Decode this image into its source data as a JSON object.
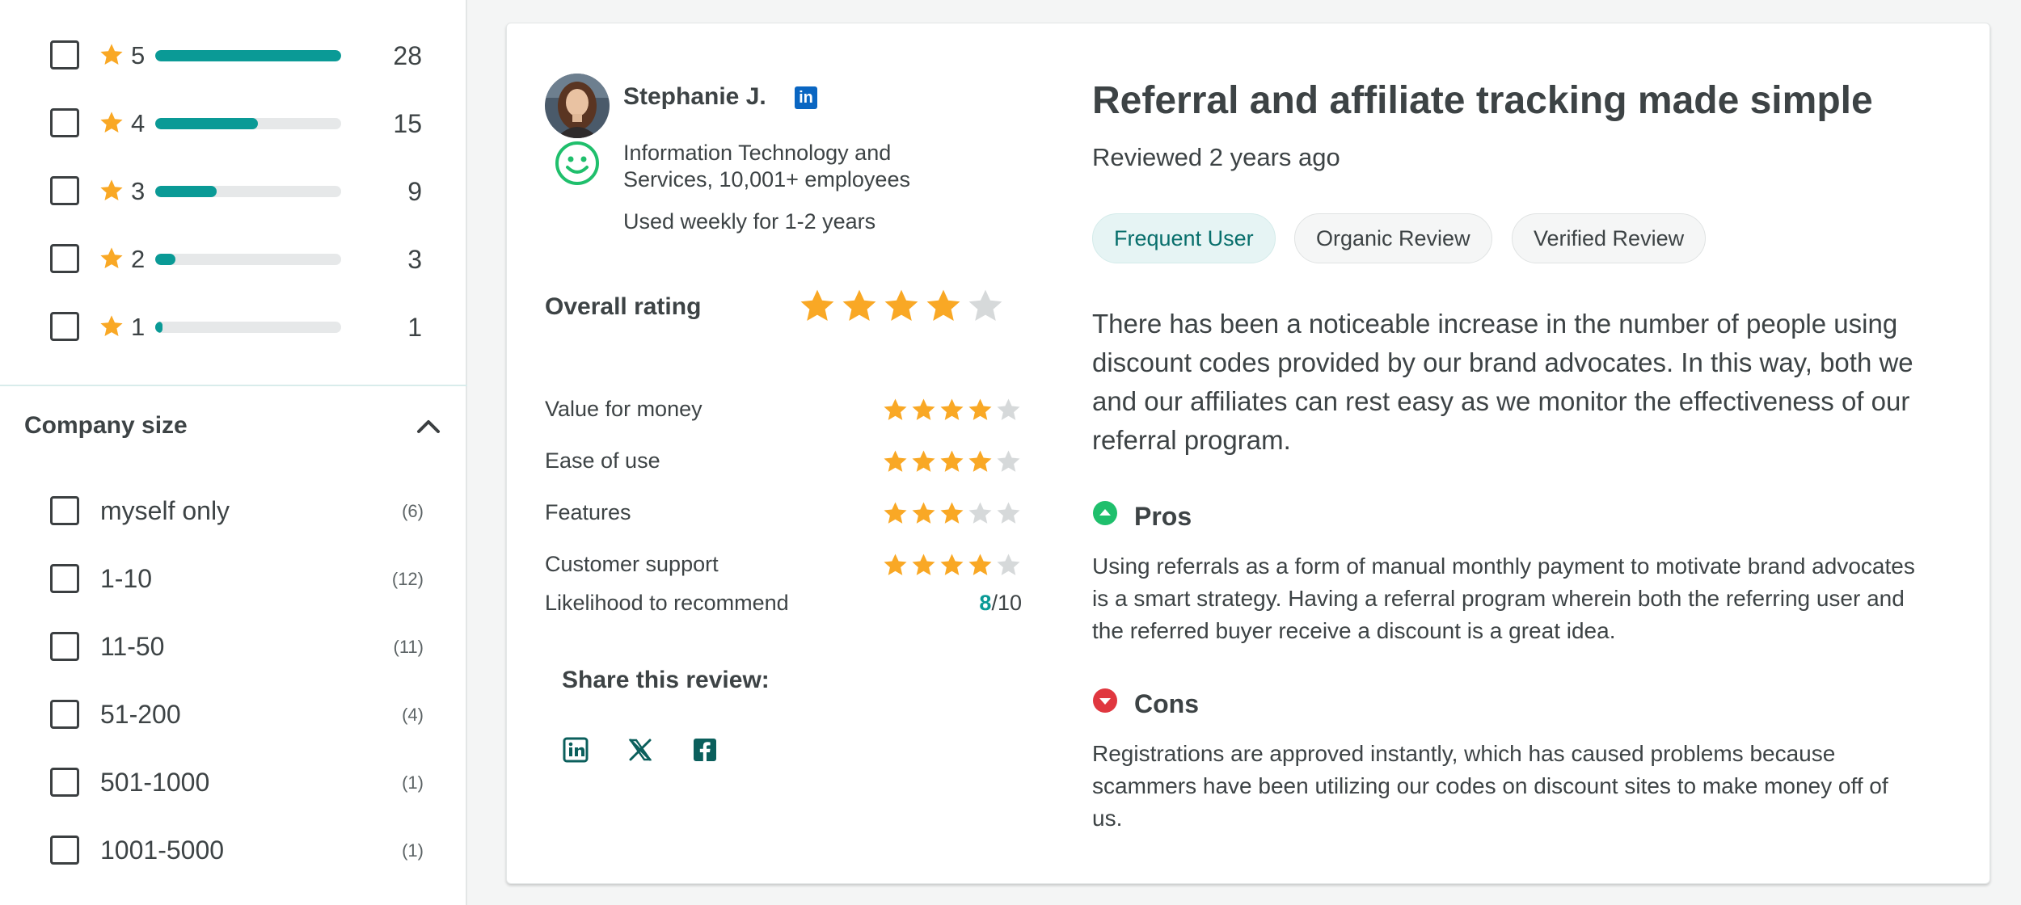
{
  "colors": {
    "accent": "#0a9a96",
    "star": "#f9a825",
    "star_empty": "#d6d9da",
    "pros": "#1fbf6c",
    "cons": "#e0373f",
    "linkedin": "#0a66c2",
    "share_icon": "#0b5f5c"
  },
  "sidebar": {
    "rating_filters": [
      {
        "stars": "5",
        "count": "28",
        "fraction": 1.0
      },
      {
        "stars": "4",
        "count": "15",
        "fraction": 0.55
      },
      {
        "stars": "3",
        "count": "9",
        "fraction": 0.33
      },
      {
        "stars": "2",
        "count": "3",
        "fraction": 0.11
      },
      {
        "stars": "1",
        "count": "1",
        "fraction": 0.04
      }
    ],
    "company_size": {
      "title": "Company size",
      "options": [
        {
          "label": "myself only",
          "count": "(6)"
        },
        {
          "label": "1-10",
          "count": "(12)"
        },
        {
          "label": "11-50",
          "count": "(11)"
        },
        {
          "label": "51-200",
          "count": "(4)"
        },
        {
          "label": "501-1000",
          "count": "(1)"
        },
        {
          "label": "1001-5000",
          "count": "(1)"
        }
      ]
    }
  },
  "review": {
    "reviewer": {
      "name": "Stephanie J.",
      "linkedin_badge": "in",
      "company": "Information Technology and Services, 10,001+ employees",
      "usage": "Used weekly for 1-2 years",
      "sentiment_icon": "smiley-icon"
    },
    "overall": {
      "label": "Overall rating",
      "stars": 4,
      "max": 5
    },
    "sub_ratings": [
      {
        "label": "Value for money",
        "stars": 4
      },
      {
        "label": "Ease of use",
        "stars": 4
      },
      {
        "label": "Features",
        "stars": 3
      },
      {
        "label": "Customer support",
        "stars": 4
      }
    ],
    "recommend": {
      "label": "Likelihood to recommend",
      "value": "8",
      "suffix": "/10"
    },
    "share": {
      "title": "Share this review:",
      "icons": [
        "linkedin-icon",
        "x-icon",
        "facebook-icon"
      ]
    },
    "title": "Referral and affiliate tracking made simple",
    "date": "Reviewed 2 years ago",
    "tags": [
      "Frequent User",
      "Organic Review",
      "Verified Review"
    ],
    "body": "There has been a noticeable increase in the number of people using discount codes provided by our brand advocates. In this way, both we and our affiliates can rest easy as we monitor the effectiveness of our referral program.",
    "pros": {
      "title": "Pros",
      "text": "Using referrals as a form of manual monthly payment to motivate brand advocates is a smart strategy. Having a referral program wherein both the referring user and the referred buyer receive a discount is a great idea."
    },
    "cons": {
      "title": "Cons",
      "text": "Registrations are approved instantly, which has caused problems because scammers have been utilizing our codes on discount sites to make money off of us."
    }
  }
}
